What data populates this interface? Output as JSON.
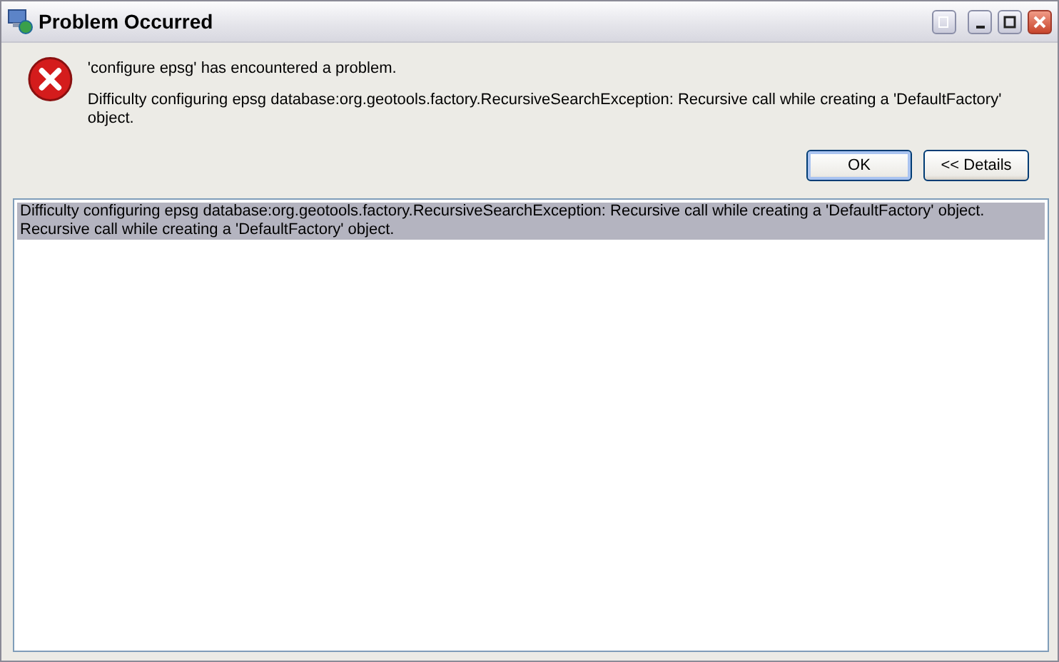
{
  "window": {
    "title": "Problem Occurred"
  },
  "message": {
    "headline": "'configure epsg' has encountered a problem.",
    "detail": "Difficulty configuring epsg database:org.geotools.factory.RecursiveSearchException: Recursive call while creating a 'DefaultFactory' object."
  },
  "buttons": [
    {
      "label": "OK",
      "default": true
    },
    {
      "label": "<< Details",
      "default": false
    }
  ],
  "details": [
    {
      "text": "Difficulty configuring epsg database:org.geotools.factory.RecursiveSearchException: Recursive call while creating a 'DefaultFactory' object.",
      "selected": true
    },
    {
      "text": "Recursive call while creating a 'DefaultFactory' object.",
      "selected": true
    }
  ]
}
